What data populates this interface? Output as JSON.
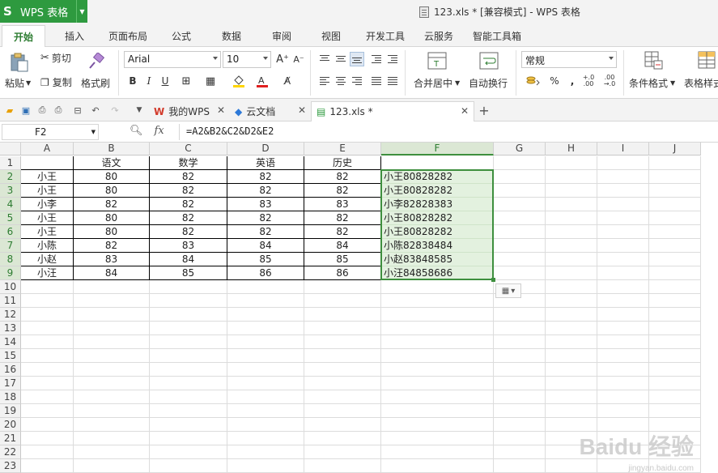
{
  "app": {
    "name": "WPS 表格",
    "logo": "S"
  },
  "window_title": "123.xls * [兼容模式] - WPS 表格",
  "ribbon_tabs": [
    "开始",
    "插入",
    "页面布局",
    "公式",
    "数据",
    "审阅",
    "视图",
    "开发工具",
    "云服务",
    "智能工具箱"
  ],
  "toolbar": {
    "paste": "粘贴",
    "cut": "剪切",
    "copy": "复制",
    "format_painter": "格式刷",
    "font_name": "Arial",
    "font_size": "10",
    "merge_center": "合并居中",
    "wrap_text": "自动换行",
    "number_format": "常规",
    "conditional_format": "条件格式",
    "table_style": "表格样式",
    "bold": "B",
    "italic": "I",
    "underline": "U",
    "percent": "%",
    "comma": ","
  },
  "doc_tabs": [
    {
      "label": "我的WPS"
    },
    {
      "label": "云文档"
    },
    {
      "label": "123.xls *"
    }
  ],
  "formula_bar": {
    "cell_ref": "F2",
    "fx": "fx",
    "formula": "=A2&B2&C2&D2&E2"
  },
  "columns": [
    "A",
    "B",
    "C",
    "D",
    "E",
    "F",
    "G",
    "H",
    "I",
    "J"
  ],
  "rows": [
    "1",
    "2",
    "3",
    "4",
    "5",
    "6",
    "7",
    "8",
    "9",
    "10",
    "11",
    "12",
    "13",
    "14",
    "15",
    "16",
    "17",
    "18",
    "19",
    "20",
    "21",
    "22",
    "23"
  ],
  "sheet": {
    "headers": [
      "",
      "语文",
      "数学",
      "英语",
      "历史"
    ],
    "data": [
      [
        "小王",
        "80",
        "82",
        "82",
        "82",
        "小王80828282"
      ],
      [
        "小王",
        "80",
        "82",
        "82",
        "82",
        "小王80828282"
      ],
      [
        "小李",
        "82",
        "82",
        "83",
        "83",
        "小李82828383"
      ],
      [
        "小王",
        "80",
        "82",
        "82",
        "82",
        "小王80828282"
      ],
      [
        "小王",
        "80",
        "82",
        "82",
        "82",
        "小王80828282"
      ],
      [
        "小陈",
        "82",
        "83",
        "84",
        "84",
        "小陈82838484"
      ],
      [
        "小赵",
        "83",
        "84",
        "85",
        "85",
        "小赵83848585"
      ],
      [
        "小汪",
        "84",
        "85",
        "86",
        "86",
        "小汪84858686"
      ]
    ]
  },
  "watermark": {
    "text": "Baidu 经验",
    "sub": "jingyan.baidu.com"
  }
}
